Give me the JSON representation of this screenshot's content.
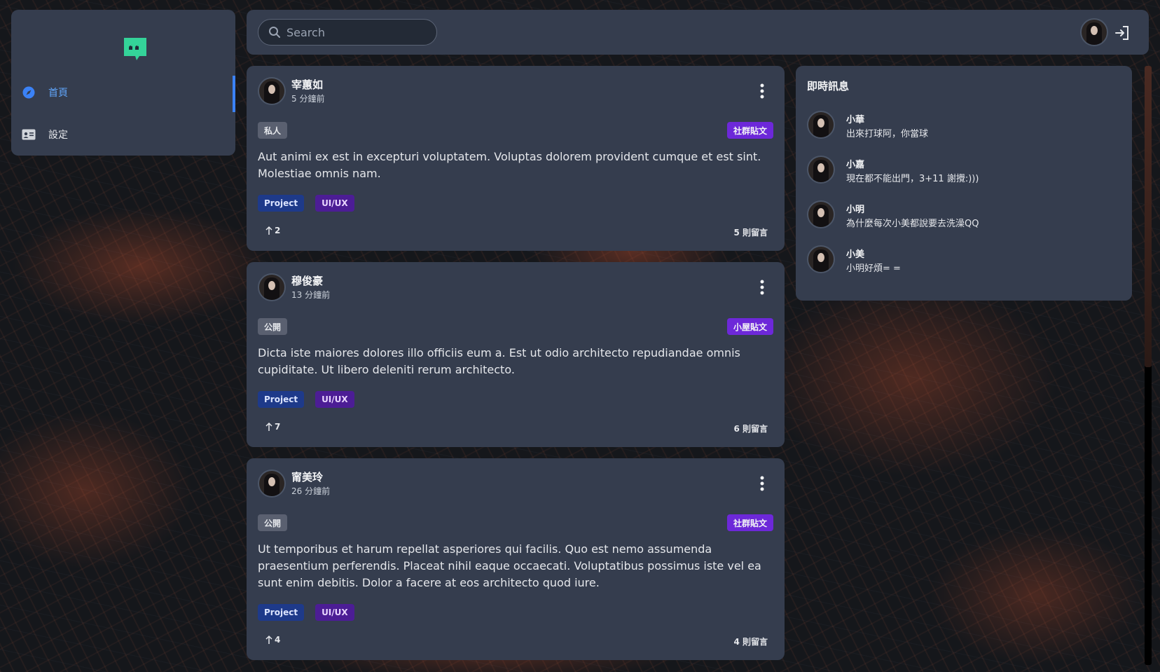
{
  "sidebar": {
    "logo_icon": "quote-chat-icon",
    "items": [
      {
        "label": "首頁",
        "icon": "compass-icon",
        "active": true
      },
      {
        "label": "設定",
        "icon": "id-card-icon",
        "active": false
      }
    ]
  },
  "header": {
    "search": {
      "placeholder": "Search",
      "value": ""
    },
    "avatar": "user-avatar",
    "logout_icon": "logout-icon"
  },
  "posts": [
    {
      "author": "宰蕙如",
      "time": "5 分鐘前",
      "visibility": "私人",
      "type": "社群貼文",
      "body": "Aut animi ex est in excepturi voluptatem. Voluptas dolorem provident cumque et est sint. Molestiae omnis nam.",
      "tags": [
        "Project",
        "UI/UX"
      ],
      "upvotes": "2",
      "comments": "5 則留言"
    },
    {
      "author": "穆俊豪",
      "time": "13 分鐘前",
      "visibility": "公開",
      "type": "小屋貼文",
      "body": "Dicta iste maiores dolores illo officiis eum a. Est ut odio architecto repudiandae omnis cupiditate. Ut libero deleniti rerum architecto.",
      "tags": [
        "Project",
        "UI/UX"
      ],
      "upvotes": "7",
      "comments": "6 則留言"
    },
    {
      "author": "甯美玲",
      "time": "26 分鐘前",
      "visibility": "公開",
      "type": "社群貼文",
      "body": "Ut temporibus et harum repellat asperiores qui facilis. Quo est nemo assumenda praesentium perferendis. Placeat nihil eaque occaecati. Voluptatibus possimus iste vel ea sunt enim debitis. Dolor a facere at eos architecto quod iure.",
      "tags": [
        "Project",
        "UI/UX"
      ],
      "upvotes": "4",
      "comments": "4 則留言"
    }
  ],
  "chat": {
    "title": "即時訊息",
    "messages": [
      {
        "name": "小華",
        "text": "出來打球阿，你當球"
      },
      {
        "name": "小嘉",
        "text": "現在都不能出門，3+11 謝攪:)))"
      },
      {
        "name": "小明",
        "text": "為什麼每次小美都說要去洗澡QQ"
      },
      {
        "name": "小美",
        "text": "小明好煩= ="
      }
    ]
  },
  "colors": {
    "panel": "#353d4e",
    "accent": "#3b82f6",
    "logo": "#34d399",
    "type_badge": "#6d28d9",
    "tag_project": "#1e3a8a",
    "tag_uiux": "#4c1d95"
  }
}
